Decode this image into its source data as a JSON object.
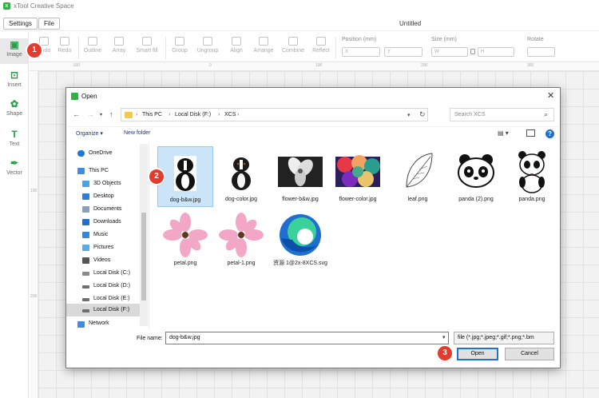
{
  "app": {
    "title": "xTool Creative Space",
    "logo_letter": "x",
    "document_title": "Untitled"
  },
  "menu": {
    "settings": "Settings",
    "file": "File"
  },
  "toolbar": {
    "tools": [
      "Undo",
      "Redo",
      "Outline",
      "Array",
      "Smart fill",
      "Group",
      "Ungroup",
      "Align",
      "Arrange",
      "Combine",
      "Reflect"
    ],
    "position_label": "Position (mm)",
    "x_placeholder": "X",
    "y_placeholder": "Y",
    "size_label": "Size (mm)",
    "w_placeholder": "W",
    "h_placeholder": "H",
    "rotate_label": "Rotate"
  },
  "sidebar": {
    "items": [
      "Image",
      "Insert",
      "Shape",
      "Text",
      "Vector"
    ]
  },
  "ruler": {
    "top": [
      "-100",
      "0",
      "100",
      "200",
      "300"
    ],
    "left": [
      "100",
      "200"
    ]
  },
  "dialog": {
    "title": "Open",
    "breadcrumb": [
      "This PC",
      "Local Disk (F:)",
      "XCS"
    ],
    "search_placeholder": "Search XCS",
    "organize": "Organize ▾",
    "new_folder": "New folder",
    "nav_items": [
      "OneDrive",
      "This PC",
      "3D Objects",
      "Desktop",
      "Documents",
      "Downloads",
      "Music",
      "Pictures",
      "Videos",
      "Local Disk (C:)",
      "Local Disk (D:)",
      "Local Disk (E:)",
      "Local Disk (F:)",
      "Network"
    ],
    "files": [
      "dog-b&w.jpg",
      "dog-color.jpg",
      "flower-b&w.jpg",
      "flower-color.jpg",
      "leaf.png",
      "panda (2).png",
      "panda.png",
      "petal.png",
      "petal-1.png",
      "资源 1@2x-8XCS.svg"
    ],
    "filename_label": "File name:",
    "filename_value": "dog-b&w.jpg",
    "filetype": "file (*.jpg;*.jpeg;*.gif;*.png;*.bm",
    "open": "Open",
    "cancel": "Cancel"
  },
  "steps": [
    "1",
    "2",
    "3"
  ],
  "colors": {
    "accent_green": "#2fb344",
    "step_red": "#e33b2e",
    "selection": "#cce4f7"
  }
}
